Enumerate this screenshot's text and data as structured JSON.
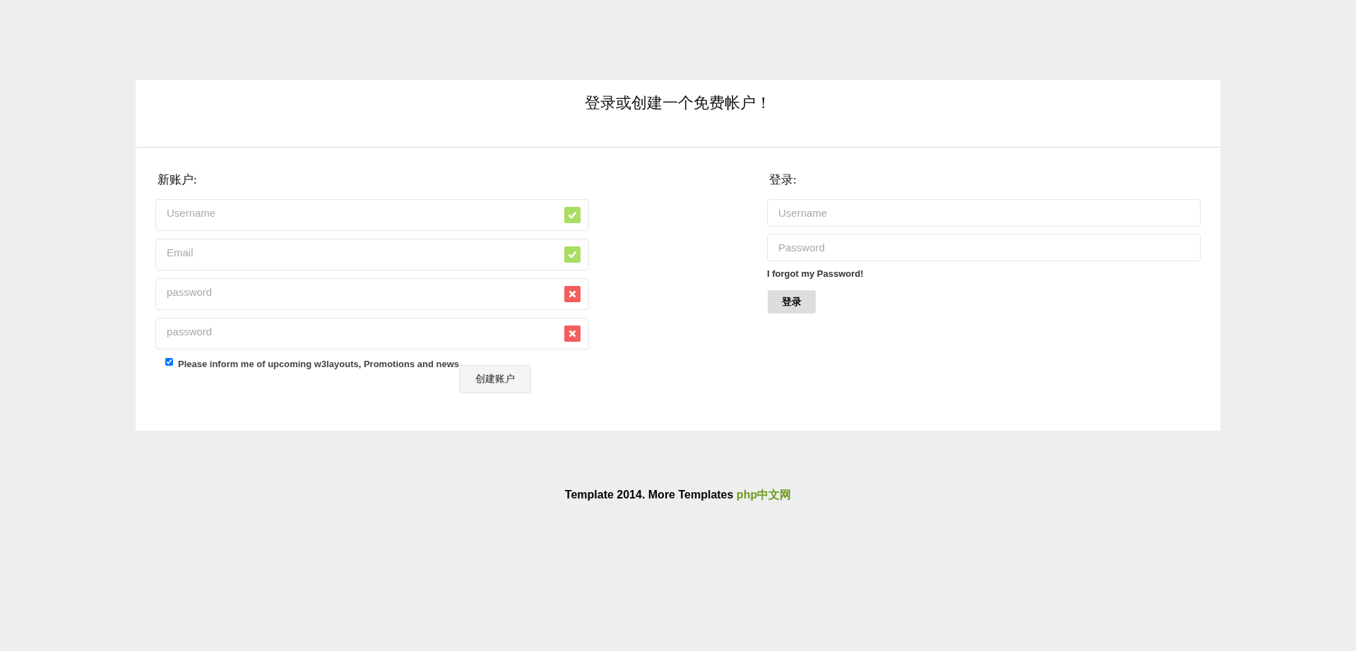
{
  "title": "登录或创建一个免费帐户！",
  "signup": {
    "heading": "新账户:",
    "fields": [
      {
        "placeholder": "Username",
        "valid": true
      },
      {
        "placeholder": "Email",
        "valid": true
      },
      {
        "placeholder": "password",
        "valid": false
      },
      {
        "placeholder": "password",
        "valid": false
      }
    ],
    "newsletter": {
      "label": "Please inform me of upcoming w3layouts, Promotions and news",
      "checked": true
    },
    "submit": "创建账户"
  },
  "login": {
    "heading": "登录:",
    "fields": [
      {
        "placeholder": "Username"
      },
      {
        "placeholder": "Password"
      }
    ],
    "forgot": "I forgot my Password!",
    "submit": "登录"
  },
  "footer": {
    "text": "Template 2014. More Templates",
    "link": "php中文网"
  }
}
